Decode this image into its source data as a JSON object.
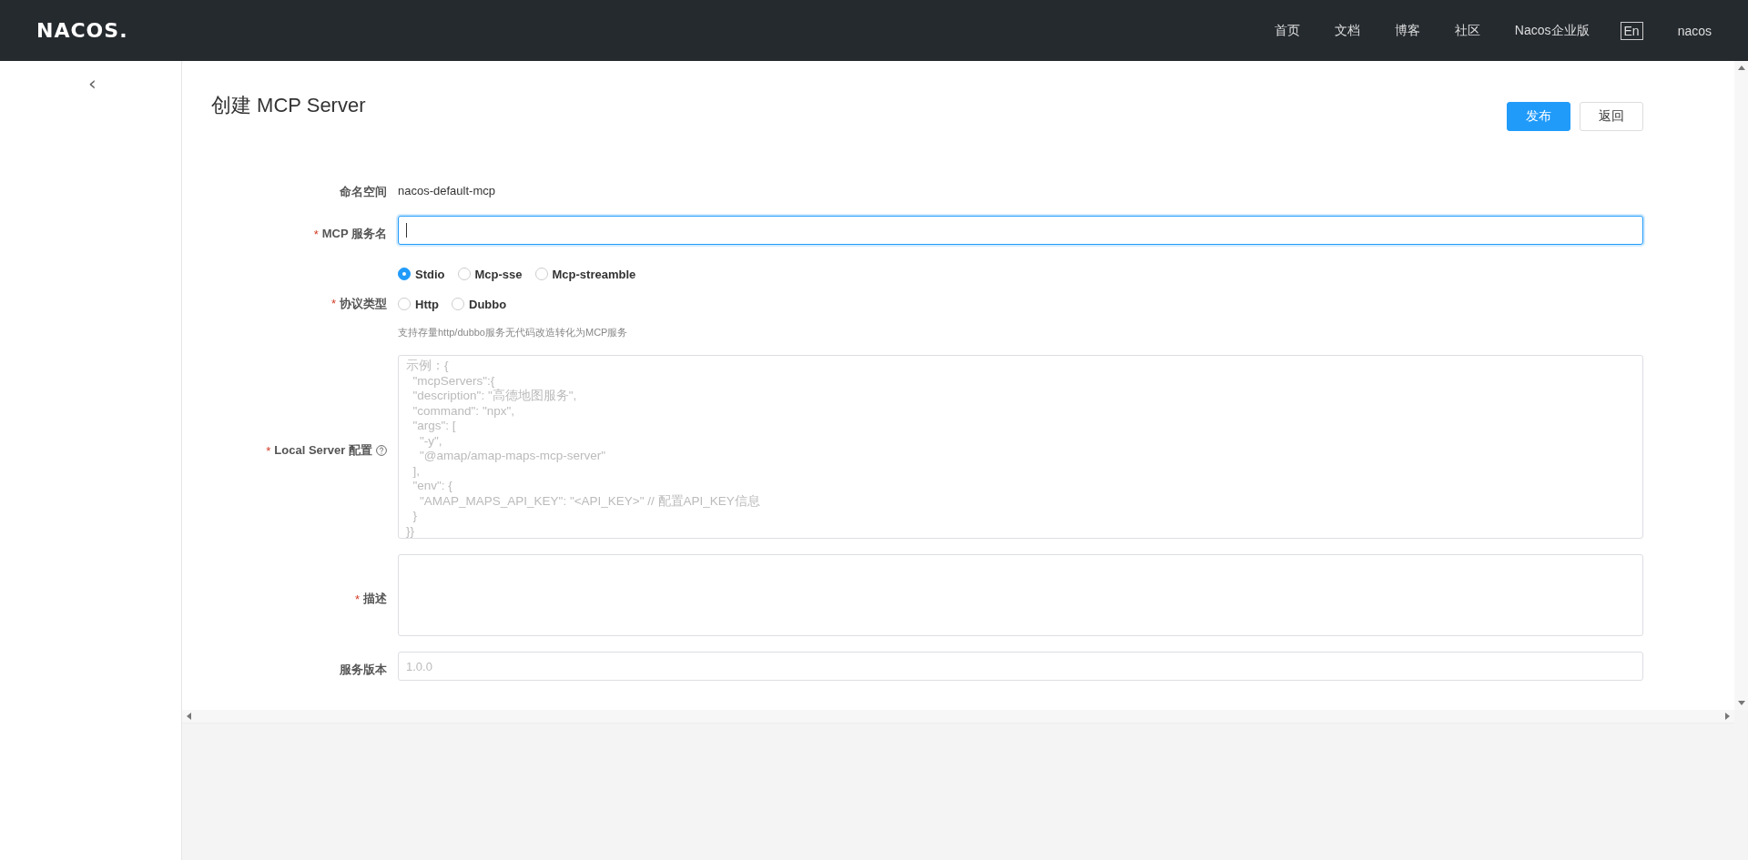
{
  "header": {
    "logo": "NACOS.",
    "nav": [
      {
        "label": "首页",
        "kind": "link"
      },
      {
        "label": "文档",
        "kind": "link"
      },
      {
        "label": "博客",
        "kind": "link"
      },
      {
        "label": "社区",
        "kind": "link"
      },
      {
        "label": "Nacos企业版",
        "kind": "link"
      },
      {
        "label": "En",
        "kind": "boxed"
      },
      {
        "label": "nacos",
        "kind": "link"
      }
    ]
  },
  "sidebar": {
    "collapse": "‹"
  },
  "page": {
    "title": "创建 MCP Server",
    "buttons": [
      {
        "label": "发布",
        "kind": "primary"
      },
      {
        "label": "返回",
        "kind": "normal"
      }
    ]
  },
  "form": {
    "fields": [
      {
        "kind": "static",
        "label": "命名空间",
        "value": "nacos-default-mcp"
      },
      {
        "kind": "input",
        "label": "MCP 服务名",
        "required_mark": "*",
        "focused": true
      },
      {
        "kind": "radio",
        "label": "协议类型",
        "required_mark": "*",
        "options": [
          {
            "label": "Stdio",
            "selected": true
          },
          {
            "label": "Mcp-sse",
            "selected": false
          },
          {
            "label": "Mcp-streamble",
            "selected": false
          },
          {
            "label": "Http",
            "selected": false
          },
          {
            "label": "Dubbo",
            "selected": false
          }
        ],
        "help": "支持存量http/dubbo服务无代码改造转化为MCP服务"
      },
      {
        "kind": "codearea",
        "label": "Local Server 配置",
        "required_mark": "*",
        "info": true,
        "placeholder": "示例：{\n  \"mcpServers\":{\n  \"description\": \"高德地图服务\",\n  \"command\": \"npx\",\n  \"args\": [\n    \"-y\",\n    \"@amap/amap-maps-mcp-server\"\n  ],\n  \"env\": {\n    \"AMAP_MAPS_API_KEY\": \"<API_KEY>\" // 配置API_KEY信息\n  }\n}}"
      },
      {
        "kind": "textarea",
        "label": "描述",
        "required_mark": "*"
      },
      {
        "kind": "input",
        "label": "服务版本",
        "focused": false,
        "placeholder": "1.0.0"
      }
    ]
  }
}
